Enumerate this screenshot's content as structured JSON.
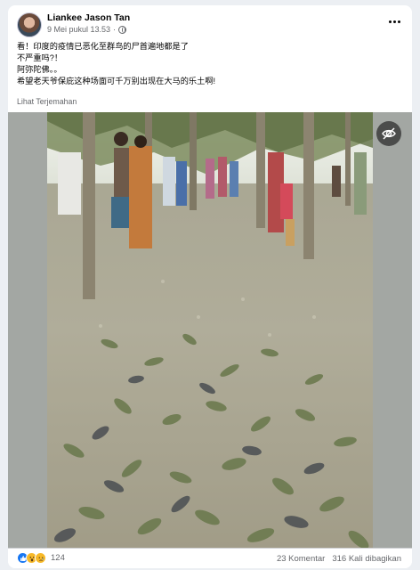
{
  "post": {
    "author": "Liankee Jason Tan",
    "date": "9 Mei pukul 13.53",
    "privacy_icon": "globe-icon",
    "menu_icon": "more-options-icon",
    "lines": [
      "看！印度的疫情已恶化至群鸟的尸首遍地都是了",
      "不严重吗?！",
      "阿弥陀佛。。",
      "希望老天爷保庇这种场面可千万别出现在大马的乐土啊!"
    ],
    "translate_label": "Lihat Terjemahan"
  },
  "media": {
    "overlay_icon": "eye-off-icon"
  },
  "footer": {
    "reaction_icons": [
      "like-icon",
      "wow-icon",
      "sad-icon"
    ],
    "reaction_count": "124",
    "comments": "23 Komentar",
    "shares": "316 Kali dibagikan"
  },
  "colors": {
    "like": "#1877f2",
    "secondary_text": "#65676b",
    "background": "#eceff3"
  }
}
